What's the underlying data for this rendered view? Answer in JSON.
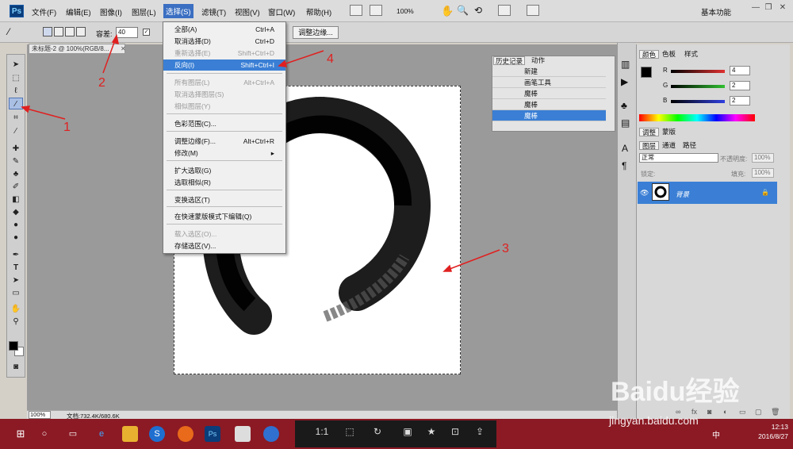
{
  "menubar": {
    "items": [
      "文件(F)",
      "编辑(E)",
      "图像(I)",
      "图层(L)",
      "选择(S)",
      "滤镜(T)",
      "视图(V)",
      "窗口(W)",
      "帮助(H)"
    ],
    "zoom": "100%",
    "workspace": "基本功能"
  },
  "options": {
    "tolerance_label": "容差:",
    "tolerance_value": "40",
    "refine_edge": "调整边缘..."
  },
  "document": {
    "tab_title": "未标题-2 @ 100%(RGB/8...",
    "zoom_status": "100%",
    "doc_info": "文档:732.4K/680.6K"
  },
  "select_menu": {
    "items": [
      {
        "label": "全部(A)",
        "shortcut": "Ctrl+A",
        "disabled": false
      },
      {
        "label": "取消选择(D)",
        "shortcut": "Ctrl+D",
        "disabled": false
      },
      {
        "label": "重新选择(E)",
        "shortcut": "Shift+Ctrl+D",
        "disabled": true
      },
      {
        "label": "反向(I)",
        "shortcut": "Shift+Ctrl+I",
        "disabled": false,
        "highlighted": true
      },
      {
        "label": "所有图层(L)",
        "shortcut": "Alt+Ctrl+A",
        "disabled": true
      },
      {
        "label": "取消选择图层(S)",
        "shortcut": "",
        "disabled": true
      },
      {
        "label": "相似图层(Y)",
        "shortcut": "",
        "disabled": true
      },
      {
        "label": "色彩范围(C)...",
        "shortcut": "",
        "disabled": false
      },
      {
        "label": "调整边缘(F)...",
        "shortcut": "Alt+Ctrl+R",
        "disabled": false
      },
      {
        "label": "修改(M)",
        "shortcut": "▸",
        "disabled": false
      },
      {
        "label": "扩大选取(G)",
        "shortcut": "",
        "disabled": false
      },
      {
        "label": "选取相似(R)",
        "shortcut": "",
        "disabled": false
      },
      {
        "label": "变换选区(T)",
        "shortcut": "",
        "disabled": false
      },
      {
        "label": "在快速蒙版模式下编辑(Q)",
        "shortcut": "",
        "disabled": false
      },
      {
        "label": "载入选区(O)...",
        "shortcut": "",
        "disabled": true
      },
      {
        "label": "存储选区(V)...",
        "shortcut": "",
        "disabled": false
      }
    ]
  },
  "history": {
    "tabs": [
      "历史记录",
      "动作"
    ],
    "rows": [
      "新建",
      "画笔工具",
      "魔棒",
      "魔棒",
      "魔棒"
    ]
  },
  "color_panel": {
    "tabs": [
      "颜色",
      "色板",
      "样式"
    ],
    "channels": [
      {
        "name": "R",
        "value": "4",
        "color": "#e03030"
      },
      {
        "name": "G",
        "value": "2",
        "color": "#30c030"
      },
      {
        "name": "B",
        "value": "2",
        "color": "#3040e0"
      }
    ]
  },
  "adjust_panel": {
    "tabs": [
      "调整",
      "蒙版"
    ]
  },
  "layers_panel": {
    "tabs": [
      "图层",
      "通道",
      "路径"
    ],
    "blend_mode": "正常",
    "opacity_label": "不透明度:",
    "opacity_value": "100%",
    "lock_label": "锁定:",
    "fill_label": "填充:",
    "fill_value": "100%",
    "layer_name": "背景"
  },
  "taskbar": {
    "center_items": [
      "1:1"
    ],
    "clock": "12:13",
    "date": "2016/8/27",
    "ime": "中"
  },
  "annotations": [
    "1",
    "2",
    "3",
    "4"
  ],
  "watermark": {
    "brand": "Baidu经验",
    "url": "jingyan.baidu.com"
  }
}
